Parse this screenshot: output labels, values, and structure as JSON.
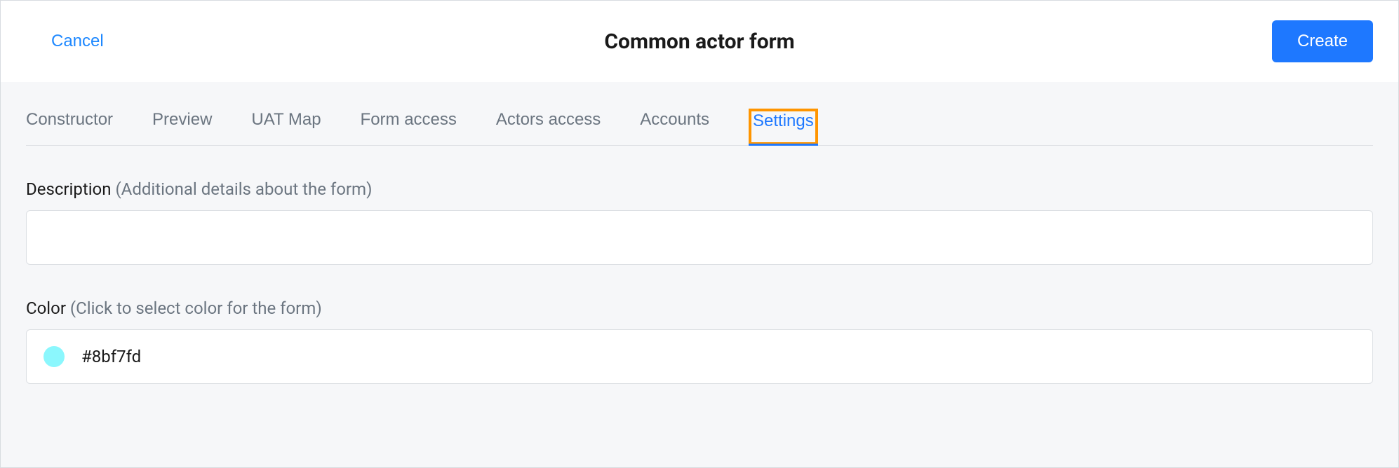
{
  "header": {
    "cancel_label": "Cancel",
    "title": "Common actor form",
    "create_label": "Create"
  },
  "tabs": {
    "items": [
      {
        "label": "Constructor"
      },
      {
        "label": "Preview"
      },
      {
        "label": "UAT Map"
      },
      {
        "label": "Form access"
      },
      {
        "label": "Actors access"
      },
      {
        "label": "Accounts"
      },
      {
        "label": "Settings"
      }
    ],
    "active_index": 6,
    "highlighted_index": 6
  },
  "settings": {
    "description": {
      "label": "Description",
      "hint": "(Additional details about the form)",
      "value": ""
    },
    "color": {
      "label": "Color",
      "hint": "(Click to select color for the form)",
      "value": "#8bf7fd",
      "swatch": "#8bf7fd"
    }
  }
}
